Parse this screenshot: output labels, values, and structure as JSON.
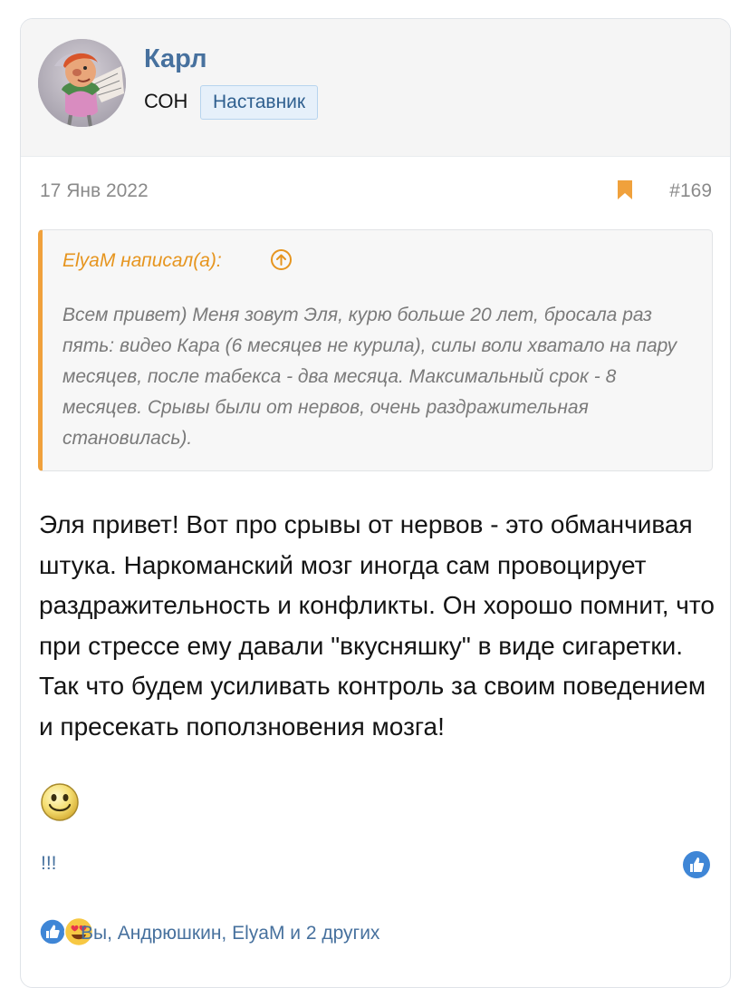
{
  "user": {
    "name": "Карл",
    "title": "СОН",
    "badge": "Наставник",
    "avatar": "avatar-image"
  },
  "post": {
    "date": "17 Янв 2022",
    "number": "#169",
    "bookmark_icon": "bookmark-icon",
    "accent_color": "#f0a13c"
  },
  "quote": {
    "author": "ElyaM написал(а):",
    "jump_icon": "arrow-up-circle-icon",
    "text": "Всем привет) Меня зовут Эля, курю больше 20 лет, бросала раз пять: видео Кара (6 месяцев не курила), силы воли хватало на пару месяцев, после табекса - два месяца. Максимальный срок - 8 месяцев. Срывы были от нервов, очень раздражительная становилась)."
  },
  "message": {
    "text": "Эля привет! Вот про срывы от нервов - это обманчивая штука. Наркоманский мозг иногда сам провоцирует раздражительность и конфликты. Он хорошо помнит, что при стрессе ему давали \"вкусняшку\" в виде сигаретки. Так что будем усиливать контроль за своим поведением и пресекать поползновения мозга!",
    "emoji": "smile-icon"
  },
  "signature": {
    "text": "!!!"
  },
  "actions": {
    "like_icon": "like-icon"
  },
  "reactions": {
    "icons": [
      "like-icon",
      "heart-eyes-icon"
    ],
    "text": "Вы, Андрюшкин, ElyaM и 2 других"
  },
  "colors": {
    "link": "#47719e",
    "quote_border": "#f0a13c",
    "badge_bg": "#e6f0fa"
  }
}
